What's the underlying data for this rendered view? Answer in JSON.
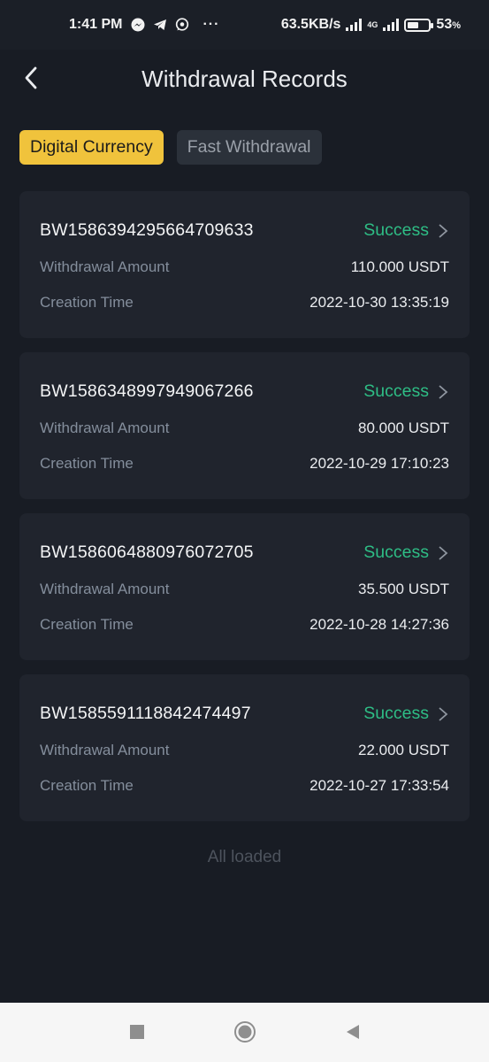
{
  "status_bar": {
    "time": "1:41 PM",
    "app_icons": [
      "messenger-icon",
      "telegram-icon",
      "whatsapp-icon"
    ],
    "more": "···",
    "network_speed": "63.5KB/s",
    "network_type": "4G",
    "battery_percent": "53",
    "battery_unit": "%",
    "battery_level": 0.53
  },
  "header": {
    "title": "Withdrawal Records",
    "back_icon": "chevron-left-icon"
  },
  "tabs": [
    {
      "label": "Digital Currency",
      "active": true
    },
    {
      "label": "Fast Withdrawal",
      "active": false
    }
  ],
  "records": [
    {
      "order_id": "BW1586394295664709633",
      "status": "Success",
      "amount_label": "Withdrawal Amount",
      "amount": "110.000 USDT",
      "time_label": "Creation Time",
      "time": "2022-10-30 13:35:19"
    },
    {
      "order_id": "BW1586348997949067266",
      "status": "Success",
      "amount_label": "Withdrawal Amount",
      "amount": "80.000 USDT",
      "time_label": "Creation Time",
      "time": "2022-10-29 17:10:23"
    },
    {
      "order_id": "BW1586064880976072705",
      "status": "Success",
      "amount_label": "Withdrawal Amount",
      "amount": "35.500 USDT",
      "time_label": "Creation Time",
      "time": "2022-10-28 14:27:36"
    },
    {
      "order_id": "BW1585591118842474497",
      "status": "Success",
      "amount_label": "Withdrawal Amount",
      "amount": "22.000 USDT",
      "time_label": "Creation Time",
      "time": "2022-10-27 17:33:54"
    }
  ],
  "footer_text": "All loaded",
  "colors": {
    "background": "#181c24",
    "card": "#20242d",
    "accent": "#f0c33c",
    "success": "#2ebd85",
    "muted": "#848e9c"
  },
  "nav_bar": {
    "buttons": [
      "recents-square-icon",
      "home-circle-icon",
      "back-triangle-icon"
    ]
  }
}
